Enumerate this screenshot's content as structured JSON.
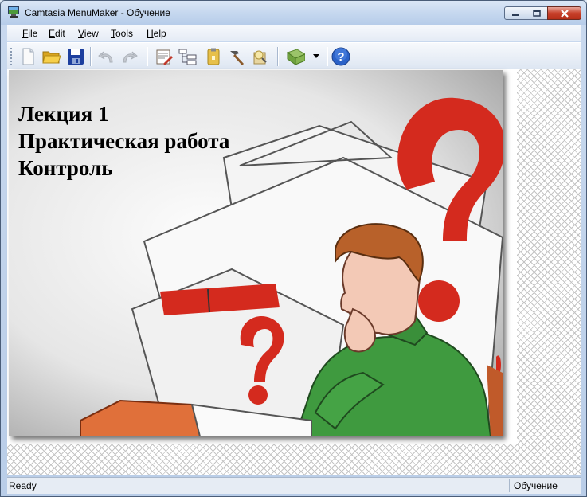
{
  "window": {
    "title": "Camtasia MenuMaker - Обучение"
  },
  "menu": {
    "items": [
      {
        "first": "F",
        "rest": "ile"
      },
      {
        "first": "E",
        "rest": "dit"
      },
      {
        "first": "V",
        "rest": "iew"
      },
      {
        "first": "T",
        "rest": "ools"
      },
      {
        "first": "H",
        "rest": "elp"
      }
    ]
  },
  "toolbar": {
    "icons": [
      "new-file-icon",
      "open-folder-icon",
      "save-icon",
      "undo-icon",
      "redo-icon",
      "properties-icon",
      "menu-tree-icon",
      "clipboard-icon",
      "build-hammer-icon",
      "preview-icon",
      "template-icon",
      "help-icon"
    ]
  },
  "slide": {
    "lines": [
      "Лекция 1",
      "Практическая работа",
      "Контроль"
    ]
  },
  "status": {
    "left": "Ready",
    "right": "Обучение"
  },
  "colors": {
    "accent_red": "#d42a1e",
    "shirt_green": "#3f9a3f",
    "title_bar": "#c6d8ef"
  }
}
